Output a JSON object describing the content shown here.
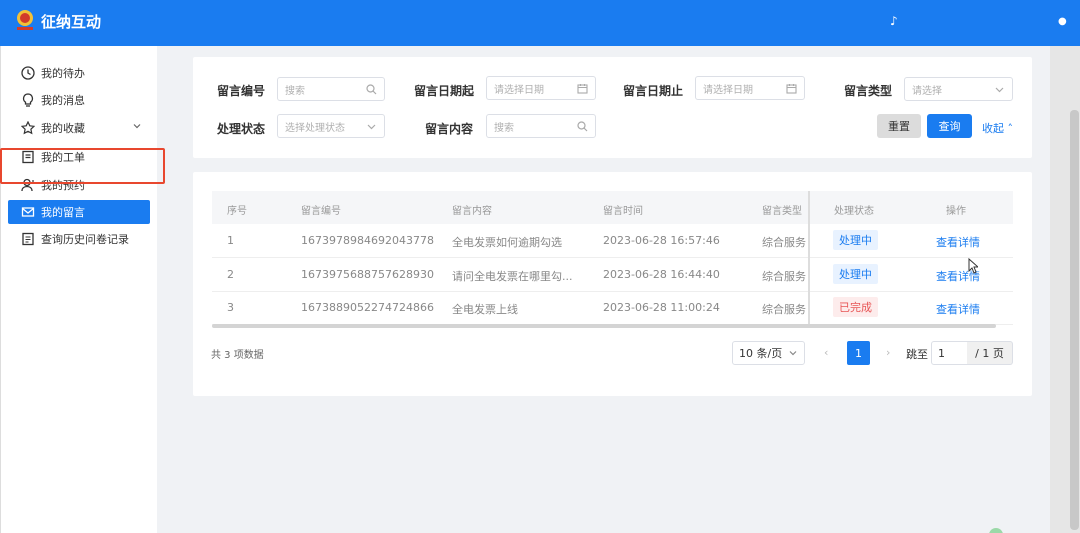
{
  "app": {
    "title": "征纳互动",
    "top_icons": [
      "music-note-icon",
      "small-dot-icon"
    ]
  },
  "sidebar": {
    "items": [
      {
        "label": "我的待办",
        "icon": "clock-icon"
      },
      {
        "label": "我的消息",
        "icon": "bulb-icon"
      },
      {
        "label": "我的收藏",
        "icon": "star-icon"
      },
      {
        "label": "我的工单",
        "icon": "document-icon"
      },
      {
        "label": "我的预约",
        "icon": "user-icon"
      },
      {
        "label": "我的留言",
        "icon": "mail-icon",
        "active": true
      },
      {
        "label": "查询历史问卷记录",
        "icon": "list-icon"
      }
    ]
  },
  "filters": {
    "msg_no_label": "留言编号",
    "msg_no_placeholder": "搜索",
    "date_from_label": "留言日期起",
    "date_from_placeholder": "请选择日期",
    "date_to_label": "留言日期止",
    "date_to_placeholder": "请选择日期",
    "type_label": "留言类型",
    "type_placeholder": "请选择",
    "status_label": "处理状态",
    "status_placeholder": "选择处理状态",
    "content_label": "留言内容",
    "content_placeholder": "搜索",
    "reset_label": "重置",
    "query_label": "查询",
    "collapse_label": "收起"
  },
  "table": {
    "columns": [
      "序号",
      "留言编号",
      "留言内容",
      "留言时间",
      "留言类型",
      "处理状态",
      "操作"
    ],
    "rows": [
      {
        "index": "1",
        "msg_no": "1673978984692043778",
        "content": "全电发票如何逾期勾选",
        "time": "2023-06-28 16:57:46",
        "type": "综合服务",
        "status": "处理中",
        "status_kind": "processing",
        "action": "查看详情"
      },
      {
        "index": "2",
        "msg_no": "1673975688757628930",
        "content": "请问全电发票在哪里勾...",
        "time": "2023-06-28 16:44:40",
        "type": "综合服务",
        "status": "处理中",
        "status_kind": "processing",
        "action": "查看详情"
      },
      {
        "index": "3",
        "msg_no": "1673889052274724866",
        "content": "全电发票上线",
        "time": "2023-06-28 11:00:24",
        "type": "综合服务",
        "status": "已完成",
        "status_kind": "done",
        "action": "查看详情"
      }
    ]
  },
  "pagination": {
    "total_text": "共 3 项数据",
    "page_size": "10 条/页",
    "current_page": "1",
    "jump_label": "跳至",
    "jump_value": "1",
    "total_pages": "/ 1 页"
  },
  "colors": {
    "brand": "#1a7cf0",
    "highlight": "#e8472e",
    "done": "#e85656"
  }
}
